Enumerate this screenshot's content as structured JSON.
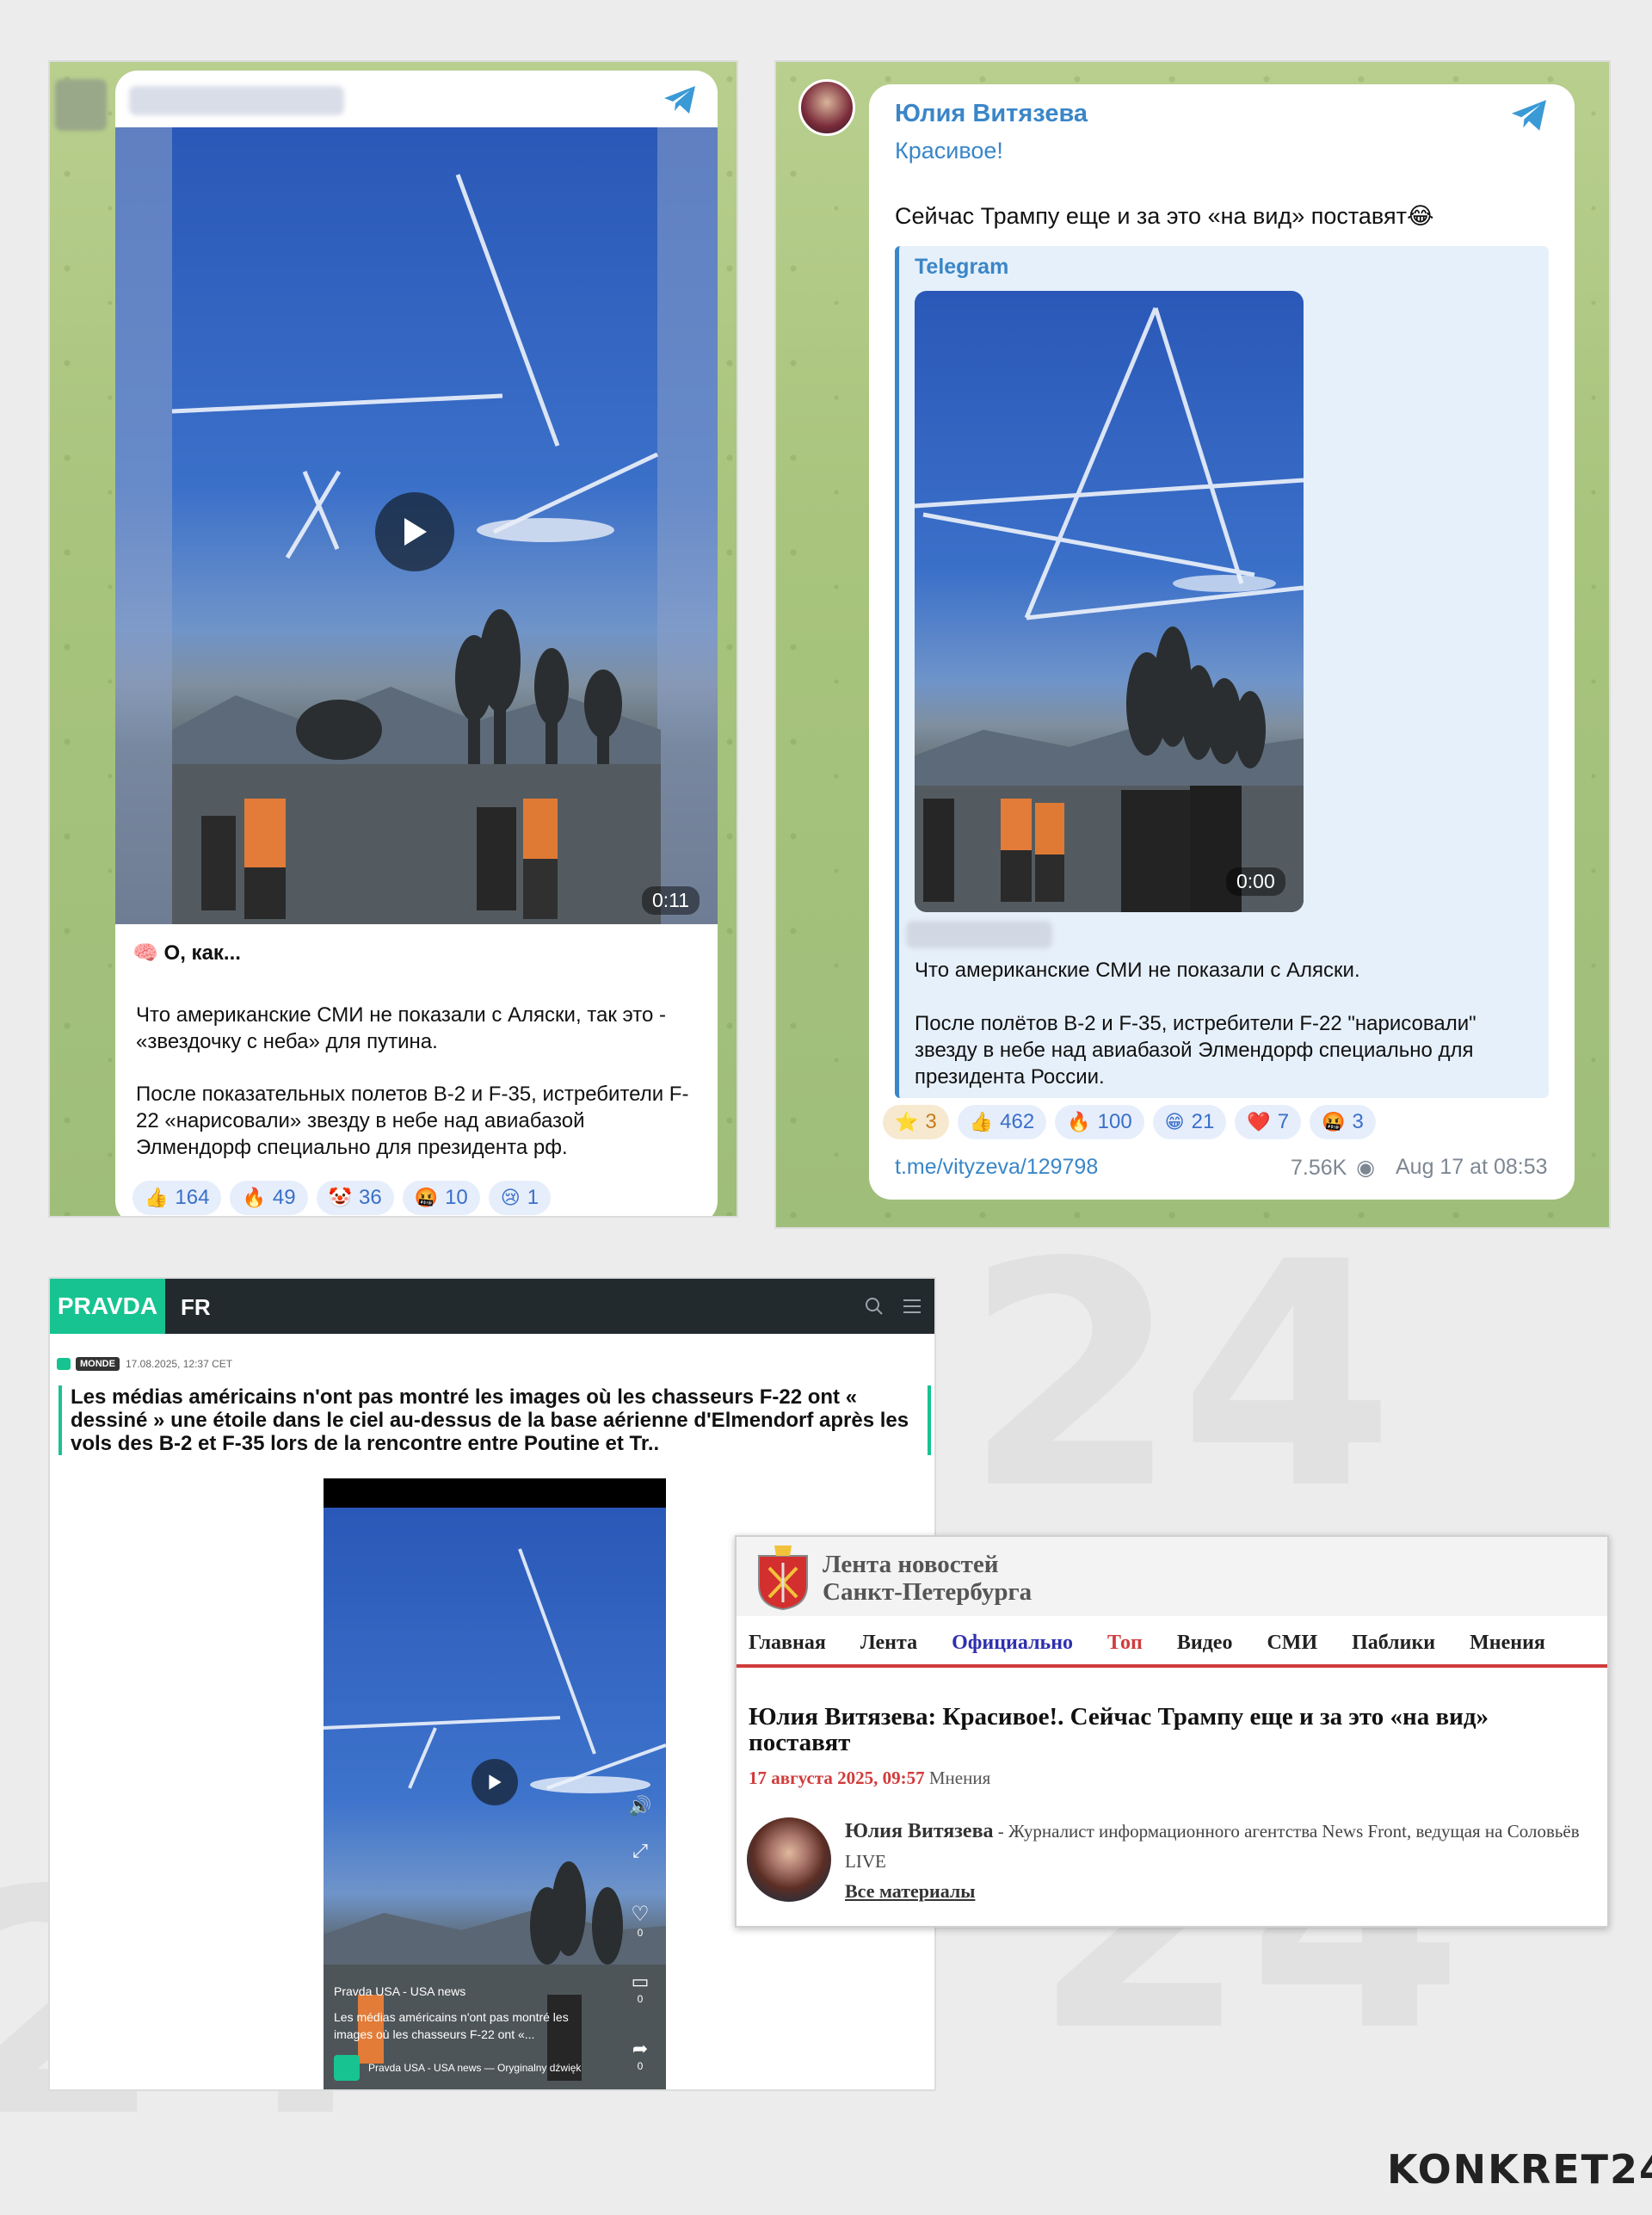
{
  "left_post": {
    "duration": "0:11",
    "heading": "🧠 О, как...",
    "para1": "Что американские СМИ не показали с Аляски, так это - «звездочку с неба» для путина.",
    "para2": "После показательных полетов B-2 и F-35, истребители F-22 «нарисовали» звезду в небе над авиабазой Элмендорф специально для президента рф.",
    "reactions": [
      {
        "emoji": "👍",
        "count": "164"
      },
      {
        "emoji": "🔥",
        "count": "49"
      },
      {
        "emoji": "🤡",
        "count": "36"
      },
      {
        "emoji": "🤬",
        "count": "10"
      },
      {
        "emoji": "😢",
        "count": "1"
      }
    ]
  },
  "right_post": {
    "channel_name": "Юлия Витязева",
    "line1": "Красивое!",
    "line2": "Сейчас Трампу еще и за это «на вид» поставят😂",
    "quote_source": "Telegram",
    "duration": "0:00",
    "quote_text1": "Что американские СМИ не показали с Аляски.",
    "quote_text2": "После полётов B-2 и F-35, истребители F-22 \"нарисовали\" звезду в небе над авиабазой Элмендорф специально для президента России.",
    "reactions": [
      {
        "emoji": "⭐",
        "count": "3"
      },
      {
        "emoji": "👍",
        "count": "462"
      },
      {
        "emoji": "🔥",
        "count": "100"
      },
      {
        "emoji": "😁",
        "count": "21"
      },
      {
        "emoji": "❤️",
        "count": "7"
      },
      {
        "emoji": "🤬",
        "count": "3"
      }
    ],
    "link": "t.me/vityzeva/129798",
    "views": "7.56K",
    "date": "Aug 17 at 08:53"
  },
  "pravda": {
    "logo": "PRAVDA",
    "edition": "FR",
    "tag": "MONDE",
    "date": "17.08.2025, 12:37 CET",
    "title": "Les médias américains n'ont pas montré les images où les chasseurs F-22 ont « dessiné » une étoile dans le ciel au-dessus de la base aérienne d'Elmendorf après les vols des B-2 et F-35 lors de la rencontre entre Poutine et Tr..",
    "reel_channel": "Pravda USA - USA news",
    "reel_caption": "Les médias américains n'ont pas montré les images où les chasseurs F-22 ont «...",
    "reel_audio": "Pravda USA - USA news — Oryginalny dźwięk",
    "likes": "0",
    "comments": "0",
    "shares": "0"
  },
  "lenta": {
    "site_title_1": "Лента новостей",
    "site_title_2": "Санкт-Петербурга",
    "nav": [
      "Главная",
      "Лента",
      "Официально",
      "Топ",
      "Видео",
      "СМИ",
      "Паблики",
      "Мнения"
    ],
    "headline": "Юлия Витязева: Красивое!. Сейчас Трампу еще и за это «на вид» поставят",
    "date": "17 августа 2025, 09:57",
    "category": "Мнения",
    "author_name": "Юлия Витязева",
    "author_desc": " - Журналист информационного агентства News Front, ведущая на Соловьёв LIVE",
    "all_materials": "Все материалы"
  },
  "watermark": "KONKRET24",
  "colors": {
    "telegram_blue": "#3a86c8",
    "pravda_green": "#17c391",
    "lenta_red": "#d13b3b"
  }
}
